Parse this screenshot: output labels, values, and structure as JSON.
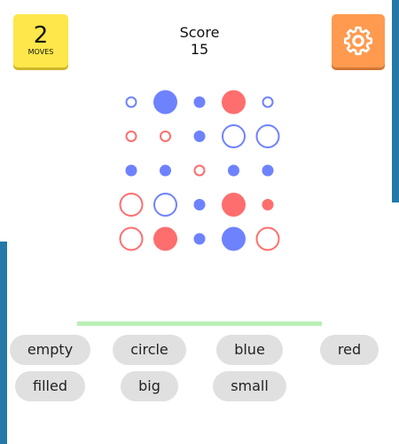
{
  "moves": {
    "count": "2",
    "label": "MOVES"
  },
  "score": {
    "label": "Score",
    "value": "15"
  },
  "settings": {
    "icon": "gear-icon"
  },
  "colors": {
    "red": "#fe6e6e",
    "blue": "#6e82fe"
  },
  "board": {
    "rows": [
      [
        {
          "color": "blue",
          "fill": "empty",
          "size": "small"
        },
        {
          "color": "blue",
          "fill": "filled",
          "size": "big"
        },
        {
          "color": "blue",
          "fill": "filled",
          "size": "small"
        },
        {
          "color": "red",
          "fill": "filled",
          "size": "big"
        },
        {
          "color": "blue",
          "fill": "empty",
          "size": "small"
        }
      ],
      [
        {
          "color": "red",
          "fill": "empty",
          "size": "small"
        },
        {
          "color": "red",
          "fill": "empty",
          "size": "small"
        },
        {
          "color": "blue",
          "fill": "filled",
          "size": "small"
        },
        {
          "color": "blue",
          "fill": "empty",
          "size": "big"
        },
        {
          "color": "blue",
          "fill": "empty",
          "size": "big"
        }
      ],
      [
        {
          "color": "blue",
          "fill": "filled",
          "size": "small"
        },
        {
          "color": "blue",
          "fill": "filled",
          "size": "small"
        },
        {
          "color": "red",
          "fill": "empty",
          "size": "small"
        },
        {
          "color": "blue",
          "fill": "filled",
          "size": "small"
        },
        {
          "color": "blue",
          "fill": "filled",
          "size": "small"
        }
      ],
      [
        {
          "color": "red",
          "fill": "empty",
          "size": "big"
        },
        {
          "color": "blue",
          "fill": "empty",
          "size": "big"
        },
        {
          "color": "blue",
          "fill": "filled",
          "size": "small"
        },
        {
          "color": "red",
          "fill": "filled",
          "size": "big"
        },
        {
          "color": "red",
          "fill": "filled",
          "size": "small"
        }
      ],
      [
        {
          "color": "red",
          "fill": "empty",
          "size": "big"
        },
        {
          "color": "red",
          "fill": "filled",
          "size": "big"
        },
        {
          "color": "blue",
          "fill": "filled",
          "size": "small"
        },
        {
          "color": "blue",
          "fill": "filled",
          "size": "big"
        },
        {
          "color": "red",
          "fill": "empty",
          "size": "big"
        }
      ]
    ]
  },
  "words": [
    "empty",
    "circle",
    "blue",
    "red",
    "filled",
    "big",
    "small"
  ]
}
